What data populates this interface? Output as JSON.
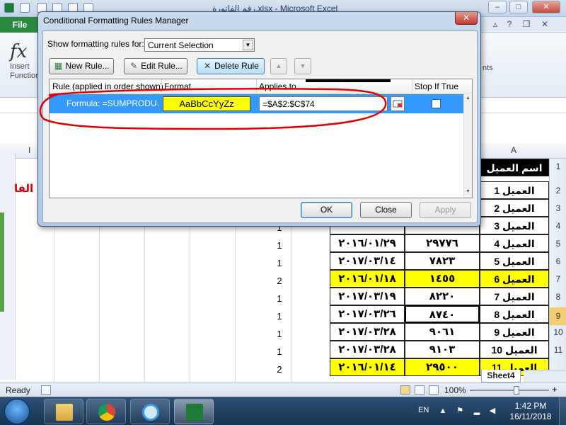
{
  "app": {
    "title": "رقم الفاتورة.xlsx - Microsoft Excel",
    "file_tab": "File"
  },
  "window_controls": {
    "minimize": "–",
    "maximize": "□",
    "close": "✕"
  },
  "ribbon": {
    "fx_symbol": "fx",
    "insert_function_label": "Insert Function",
    "right_group_label": "nts",
    "minimize_ribbon": "▵",
    "help": "?",
    "restore": "❐",
    "close": "✕"
  },
  "dialog": {
    "title": "Conditional Formatting Rules Manager",
    "close": "✕",
    "show_rules_label": "Show formatting rules for:",
    "show_rules_value": "Current Selection",
    "buttons": {
      "new_rule": "New Rule...",
      "edit_rule": "Edit Rule...",
      "delete_rule": "Delete Rule",
      "move_up": "▲",
      "move_down": "▼",
      "ok": "OK",
      "close": "Close",
      "apply": "Apply"
    },
    "columns": {
      "rule": "Rule (applied in order shown)",
      "format": "Format",
      "applies_to": "Applies to",
      "stop_if_true": "Stop If True"
    },
    "rules": [
      {
        "rule": "Formula: =SUMPRODU...",
        "format_preview": "AaBbCcYyZz",
        "applies_to": "=$A$2:$C$74",
        "stop_if_true": false
      }
    ],
    "scroll_up": "▲",
    "scroll_down": "▼"
  },
  "sheet": {
    "visible_columns": [
      "I",
      "A"
    ],
    "row_numbers": [
      "1",
      "2",
      "3",
      "4",
      "5",
      "6",
      "7",
      "8",
      "9",
      "10",
      "11"
    ],
    "active_row": "9",
    "header_cell": "اسم العميل",
    "red_text": "الفا",
    "rows": [
      {
        "flag": "",
        "date": "",
        "amount": "",
        "client": "العميل 1",
        "highlight": false
      },
      {
        "flag": "",
        "date": "",
        "amount": "",
        "client": "العميل 2",
        "highlight": false
      },
      {
        "flag": "1",
        "date": "",
        "amount": "",
        "client": "العميل 3",
        "highlight": false
      },
      {
        "flag": "1",
        "date": "٢٠١٦/٠١/٢٩",
        "amount": "٢٩٧٧٦",
        "client": "العميل 4",
        "highlight": false
      },
      {
        "flag": "1",
        "date": "٢٠١٧/٠٣/١٤",
        "amount": "٧٨٢٣",
        "client": "العميل 5",
        "highlight": false
      },
      {
        "flag": "2",
        "date": "٢٠١٦/٠١/١٨",
        "amount": "١٤٥٥",
        "client": "العميل 6",
        "highlight": true
      },
      {
        "flag": "1",
        "date": "٢٠١٧/٠٣/١٩",
        "amount": "٨٢٢٠",
        "client": "العميل 7",
        "highlight": false
      },
      {
        "flag": "1",
        "date": "٢٠١٧/٠٣/٢٦",
        "amount": "٨٧٤٠",
        "client": "العميل 8",
        "highlight": false
      },
      {
        "flag": "1",
        "date": "٢٠١٧/٠٣/٢٨",
        "amount": "٩٠٦١",
        "client": "العميل 9",
        "highlight": false
      },
      {
        "flag": "1",
        "date": "٢٠١٧/٠٣/٢٨",
        "amount": "٩١٠٣",
        "client": "العميل 10",
        "highlight": false
      },
      {
        "flag": "2",
        "date": "٢٠١٦/٠١/١٤",
        "amount": "٢٩٥٠٠",
        "client": "العميل 11",
        "highlight": true
      }
    ],
    "sheet_tab": "Sheet4"
  },
  "statusbar": {
    "ready": "Ready",
    "zoom": "100%",
    "zoom_minus": "–",
    "zoom_plus": "+"
  },
  "taskbar": {
    "language": "EN",
    "time": "1:42 PM",
    "date": "16/11/2018"
  },
  "colors": {
    "highlight_yellow": "#ffff00",
    "selection_blue": "#3399ff",
    "annotation_red": "#e00000",
    "excel_green": "#2a8a3f"
  }
}
